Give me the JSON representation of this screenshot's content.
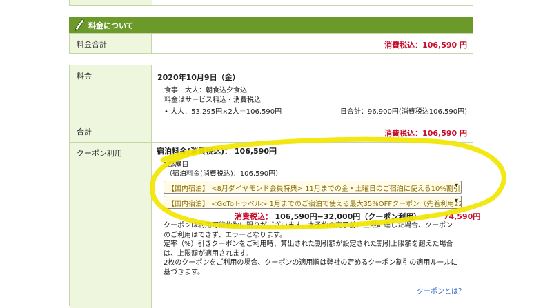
{
  "section": {
    "title": "料金について",
    "icon": "pen-icon",
    "header_color": "#6b9a2a"
  },
  "summary": {
    "label": "料金合計",
    "value": "消費税込：106,590 円"
  },
  "fee": {
    "label": "料金",
    "date": "2020年10月9日（金）",
    "meal": "食事　大人：朝食込夕食込",
    "tax_note": "料金はサービス料込・消費税込",
    "breakdown": "• 大人：53,295円×2人＝106,590円",
    "day_total": "日合計：96,900円(消費税込106,590円)"
  },
  "total": {
    "label": "合計",
    "value": "消費税込：106,590 円"
  },
  "coupon": {
    "label": "クーポン利用",
    "lodging_fee": "宿泊料金(消費税込)：  106,590円",
    "room": "1部屋目",
    "room_fee": "（宿泊料金(消費税込)：106,590円）",
    "select1": "【国内宿泊】 <8月ダイヤモンド会員特典> 11月までの金・土曜日のご宿泊に使える10%割引クー",
    "select2": "【国内宿泊】 <GoToトラベル> 1月までのご宿泊で使える最大35%OFFクーポン（先着利用222万",
    "calc_label": "消費税込：",
    "calc_expr": "106,590円−32,000円（クーポン利用） =",
    "calc_result": "74,590円",
    "notes": [
      "クーポンは利用可能枚数に限りがございます。本予約の完了前に上限に達した場合、クーポン",
      "のご利用はできず、エラーとなります。",
      "定率（%）引きクーポンをご利用時、算出された割引額が設定された割引上限額を超えた場合",
      "は、上限額が適用されます。",
      "2枚のクーポンをご利用の場合、クーポンの適用順は弊社の定めるクーポン割引の適用ルールに",
      "基づきます。"
    ],
    "link": "クーポンとは？"
  },
  "colors": {
    "border": "#c5d6a8",
    "label_bg": "#eef6de",
    "price_red": "#c8102e",
    "highlight": "#f2e600",
    "link": "#3366cc"
  }
}
